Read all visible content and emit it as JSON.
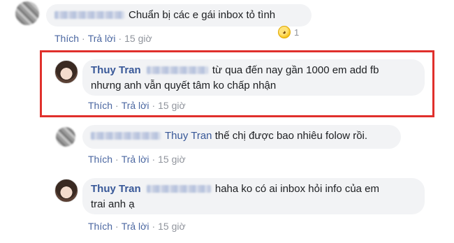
{
  "actions": {
    "like": "Thích",
    "reply": "Trả lời",
    "separator": "·"
  },
  "comments": [
    {
      "author": "",
      "text": "Chuẩn bị các e gái inbox tỏ tình",
      "time": "15 giờ",
      "reaction_icon": "laughing-emoji-icon",
      "reaction_count": "1"
    },
    {
      "author": "Thuy Tran",
      "text_line1": "từ qua đến nay gần 1000 em add fb",
      "text_line2": "nhưng anh vẫn quyết tâm ko chấp nhận",
      "time": "15 giờ",
      "highlighted": true,
      "highlight_color": "#e0302c"
    },
    {
      "author": "",
      "mention": "Thuy Tran",
      "text": "thế chị được bao nhiêu folow rồi.",
      "time": "15 giờ"
    },
    {
      "author": "Thuy Tran",
      "text_line1": "haha ko có ai inbox hỏi info của em",
      "text_line2": "trai anh ạ",
      "time": "15 giờ"
    }
  ],
  "colors": {
    "link": "#385898",
    "bubble": "#f2f3f5",
    "meta": "#90949c"
  }
}
